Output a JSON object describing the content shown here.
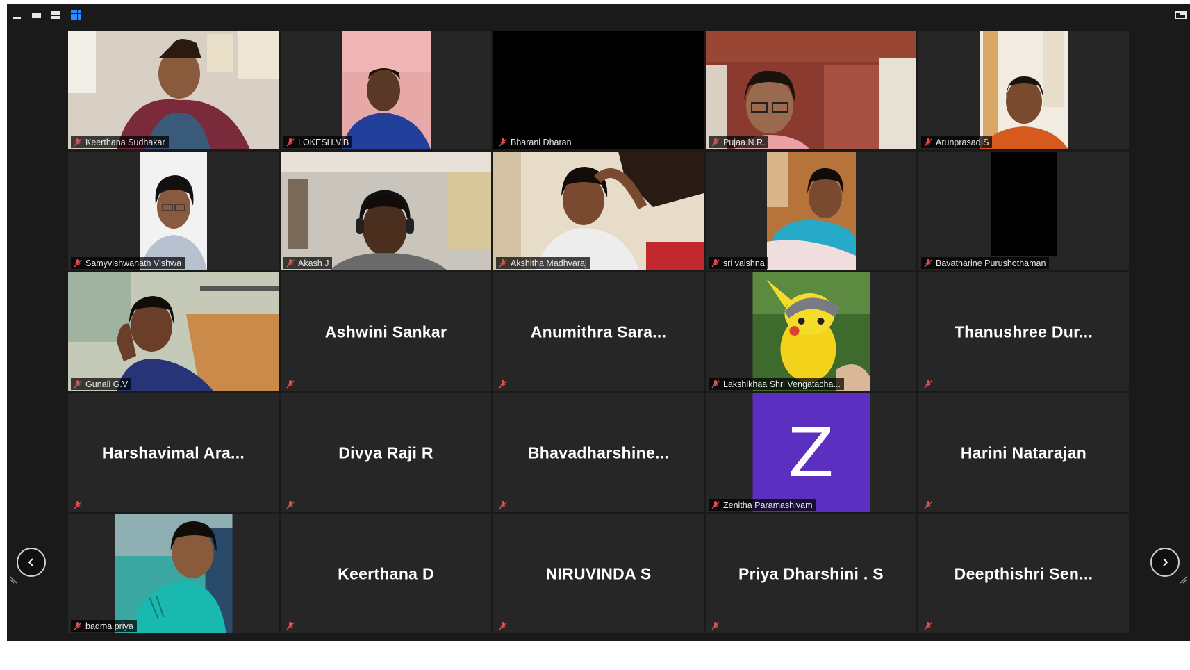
{
  "view_modes": {
    "minimize": "minimize-icon",
    "speaker": "speaker-view-icon",
    "strip": "strip-view-icon",
    "gallery": "gallery-view-icon"
  },
  "colors": {
    "background": "#1a1a1a",
    "tile": "#262626",
    "accent": "#2d8cff",
    "muted_mic": "#e05050",
    "avatar_purple": "#5b2fc0"
  },
  "participants": [
    {
      "name": "Keerthana Sudhakar",
      "tile": "video",
      "muted": true
    },
    {
      "name": "LOKESH.V.B",
      "tile": "video",
      "muted": true
    },
    {
      "name": "Bharani Dharan",
      "tile": "video",
      "muted": true
    },
    {
      "name": "Pujaa.N.R.",
      "tile": "video",
      "muted": true
    },
    {
      "name": "Arunprasad S",
      "tile": "video",
      "muted": true
    },
    {
      "name": "Samyvishwanath Vishwa",
      "tile": "video",
      "muted": true
    },
    {
      "name": "Akash J",
      "tile": "video",
      "muted": true
    },
    {
      "name": "Akshitha Madhvaraj",
      "tile": "video",
      "muted": true
    },
    {
      "name": "sri vaishna",
      "tile": "video",
      "muted": true
    },
    {
      "name": "Bavatharine Purushothaman",
      "tile": "video",
      "muted": true
    },
    {
      "name": "Gunali G.V",
      "tile": "video",
      "muted": true
    },
    {
      "display": "Ashwini Sankar",
      "tile": "name",
      "muted": true
    },
    {
      "display": "Anumithra  Sara...",
      "tile": "name",
      "muted": true
    },
    {
      "name": "Lakshikhaa Shri Vengatacha...",
      "tile": "picture",
      "muted": true
    },
    {
      "display": "Thanushree  Dur...",
      "tile": "name",
      "muted": true
    },
    {
      "display": "Harshavimal  Ara...",
      "tile": "name",
      "muted": true
    },
    {
      "display": "Divya Raji R",
      "tile": "name",
      "muted": true
    },
    {
      "display": "Bhavadharshine...",
      "tile": "name",
      "muted": true
    },
    {
      "name": "Zenitha Paramashivam",
      "tile": "avatar",
      "letter": "Z",
      "muted": true
    },
    {
      "display": "Harini Natarajan",
      "tile": "name",
      "muted": true
    },
    {
      "name": "badma priya",
      "tile": "video",
      "muted": true
    },
    {
      "display": "Keerthana D",
      "tile": "name",
      "muted": true
    },
    {
      "display": "NIRUVINDA S",
      "tile": "name",
      "muted": true
    },
    {
      "display": "Priya Dharshini . S",
      "tile": "name",
      "muted": true
    },
    {
      "display": "Deepthishri  Sen...",
      "tile": "name",
      "muted": true
    }
  ],
  "navigation": {
    "prev": "chevron-left-icon",
    "next": "chevron-right-icon"
  }
}
